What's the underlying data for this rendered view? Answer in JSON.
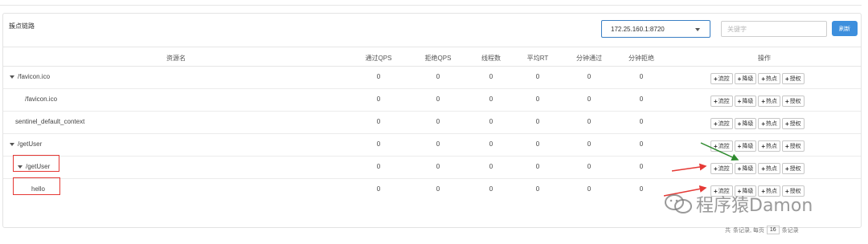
{
  "panel": {
    "title": "簇点链路"
  },
  "toolbar": {
    "machine": "172.25.160.1:8720",
    "search_placeholder": "关键字",
    "refresh_label": "刷新"
  },
  "table": {
    "headers": {
      "resource": "资源名",
      "pass_qps": "通过QPS",
      "block_qps": "拒绝QPS",
      "threads": "线程数",
      "avg_rt": "平均RT",
      "minute_pass": "分钟通过",
      "minute_block": "分钟拒绝",
      "ops": "操作"
    },
    "rows": [
      {
        "name": "/favicon.ico",
        "pass_qps": "0",
        "block_qps": "0",
        "threads": "0",
        "avg_rt": "0",
        "minute_pass": "0",
        "minute_block": "0"
      },
      {
        "name": "/favicon.ico",
        "pass_qps": "0",
        "block_qps": "0",
        "threads": "0",
        "avg_rt": "0",
        "minute_pass": "0",
        "minute_block": "0"
      },
      {
        "name": "sentinel_default_context",
        "pass_qps": "0",
        "block_qps": "0",
        "threads": "0",
        "avg_rt": "0",
        "minute_pass": "0",
        "minute_block": "0"
      },
      {
        "name": "/getUser",
        "pass_qps": "0",
        "block_qps": "0",
        "threads": "0",
        "avg_rt": "0",
        "minute_pass": "0",
        "minute_block": "0"
      },
      {
        "name": "/getUser",
        "pass_qps": "0",
        "block_qps": "0",
        "threads": "0",
        "avg_rt": "0",
        "minute_pass": "0",
        "minute_block": "0"
      },
      {
        "name": "hello",
        "pass_qps": "0",
        "block_qps": "0",
        "threads": "0",
        "avg_rt": "0",
        "minute_pass": "0",
        "minute_block": "0"
      }
    ],
    "actions": {
      "flow": "流控",
      "degrade": "降级",
      "hotspot": "热点",
      "auth": "授权"
    }
  },
  "pager": {
    "prefix": "共",
    "records_suffix": "条记录, 每页",
    "page_size": "16",
    "tail": "条记录"
  },
  "watermark": {
    "text": "程序猿Damon"
  }
}
